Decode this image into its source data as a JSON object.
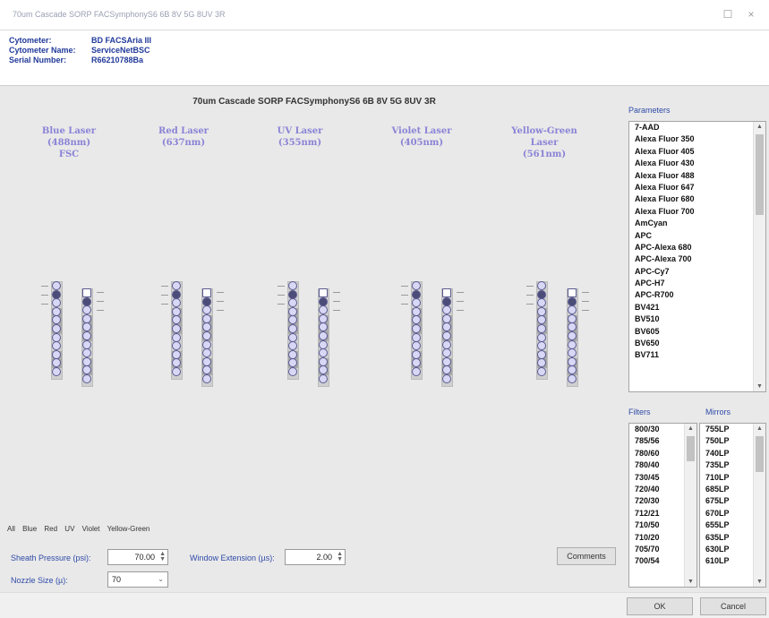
{
  "window": {
    "title": "70um Cascade SORP FACSymphonyS6 6B 8V 5G 8UV 3R",
    "minimize": "☐",
    "close": "×"
  },
  "info": {
    "cytometer_label": "Cytometer:",
    "cytometer_value": "BD FACSAria III",
    "cytometer_name_label": "Cytometer Name:",
    "cytometer_name_value": "ServiceNetBSC",
    "serial_label": "Serial Number:",
    "serial_value": "R66210788Ba"
  },
  "config_title": "70um Cascade SORP FACSymphonyS6 6B 8V 5G 8UV 3R",
  "lasers": [
    {
      "line1": "Blue Laser",
      "line2": "(488nm)",
      "line3": "FSC"
    },
    {
      "line1": "Red Laser",
      "line2": "(637nm)",
      "line3": ""
    },
    {
      "line1": "UV Laser",
      "line2": "(355nm)",
      "line3": ""
    },
    {
      "line1": "Violet Laser",
      "line2": "(405nm)",
      "line3": ""
    },
    {
      "line1": "Yellow-Green",
      "line2": "Laser",
      "line3": "(561nm)"
    }
  ],
  "tabs": [
    "All",
    "Blue",
    "Red",
    "UV",
    "Violet",
    "Yellow-Green"
  ],
  "controls": {
    "sheath_label": "Sheath Pressure (psi):",
    "sheath_value": "70.00",
    "window_label": "Window Extension (µs):",
    "window_value": "2.00",
    "nozzle_label": "Nozzle Size (µ):",
    "nozzle_value": "70",
    "comments_label": "Comments"
  },
  "parameters": {
    "label": "Parameters",
    "items": [
      "7-AAD",
      "Alexa Fluor 350",
      "Alexa Fluor 405",
      "Alexa Fluor 430",
      "Alexa Fluor 488",
      "Alexa Fluor 647",
      "Alexa Fluor 680",
      "Alexa Fluor 700",
      "AmCyan",
      "APC",
      "APC-Alexa 680",
      "APC-Alexa 700",
      "APC-Cy7",
      "APC-H7",
      "APC-R700",
      "BV421",
      "BV510",
      "BV605",
      "BV650",
      "BV711"
    ]
  },
  "filters": {
    "label": "Filters",
    "items": [
      "800/30",
      "785/56",
      "780/60",
      "780/40",
      "730/45",
      "720/40",
      "720/30",
      "712/21",
      "710/50",
      "710/20",
      "705/70",
      "700/54"
    ]
  },
  "mirrors": {
    "label": "Mirrors",
    "items": [
      "755LP",
      "750LP",
      "740LP",
      "735LP",
      "710LP",
      "685LP",
      "675LP",
      "670LP",
      "655LP",
      "635LP",
      "630LP",
      "610LP"
    ]
  },
  "footer": {
    "ok_label": "OK",
    "cancel_label": "Cancel"
  }
}
